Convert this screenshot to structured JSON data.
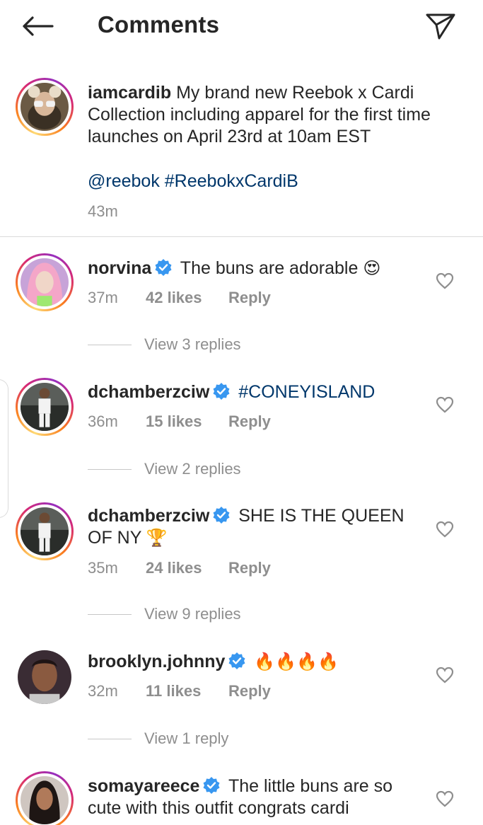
{
  "header": {
    "title": "Comments",
    "back_icon": "arrow-left-icon",
    "send_icon": "paper-plane-icon"
  },
  "caption": {
    "username": "iamcardib",
    "text": "My brand new Reebok x Cardi Collection including apparel for the first time launches on April 23rd at 10am EST",
    "mention": "@reebok",
    "hashtag": "#ReebokxCardiB",
    "time": "43m"
  },
  "comments": [
    {
      "username": "norvina",
      "verified": true,
      "text": "The buns are adorable",
      "emoji": "😍",
      "time": "37m",
      "likes": "42 likes",
      "reply": "Reply",
      "view_replies": "View 3 replies"
    },
    {
      "username": "dchamberzciw",
      "verified": true,
      "text": "#CONEYISLAND",
      "time": "36m",
      "likes": "15 likes",
      "reply": "Reply",
      "view_replies": "View 2 replies"
    },
    {
      "username": "dchamberzciw",
      "verified": true,
      "text": "SHE IS THE QUEEN OF NY",
      "emoji": "🏆",
      "time": "35m",
      "likes": "24 likes",
      "reply": "Reply",
      "view_replies": "View 9 replies"
    },
    {
      "username": "brooklyn.johnny",
      "verified": true,
      "text": "",
      "emoji": "🔥🔥🔥🔥",
      "time": "32m",
      "likes": "11 likes",
      "reply": "Reply",
      "view_replies": "View 1 reply"
    },
    {
      "username": "somayareece",
      "verified": true,
      "text": "The little buns are so cute with this outfit congrats cardi"
    }
  ],
  "colors": {
    "link": "#00376b",
    "verified": "#3897f0",
    "secondary_text": "#8e8e8e"
  }
}
